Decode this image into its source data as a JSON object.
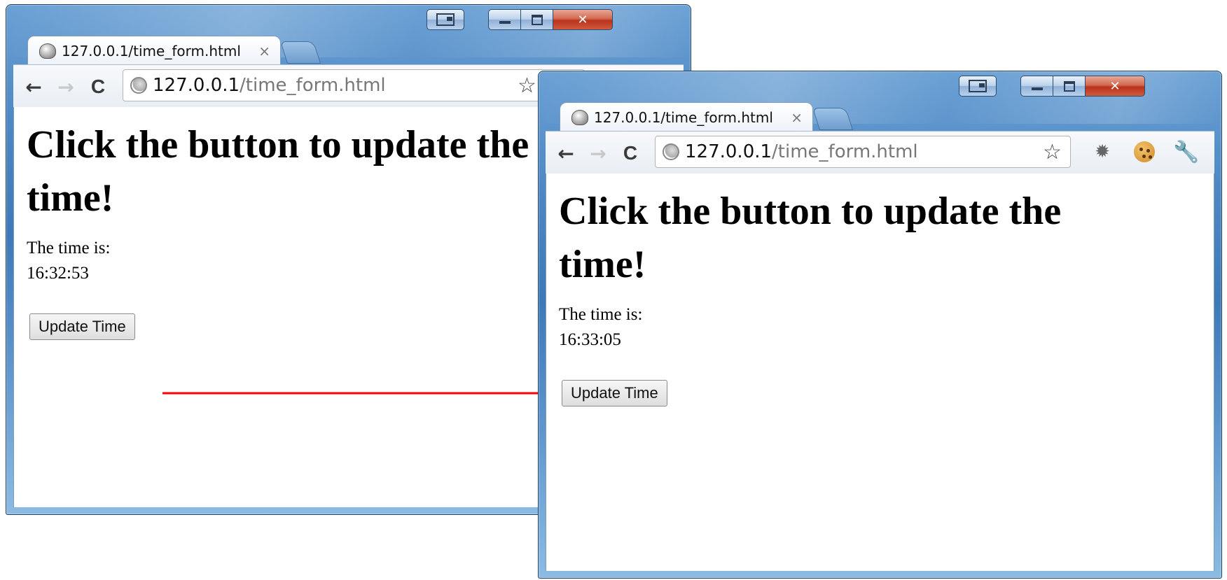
{
  "windows": [
    {
      "tab_title": "127.0.0.1/time_form.html",
      "tab_close": "×",
      "url_host": "127.0.0.1",
      "url_path": "/time_form.html",
      "heading": "Click the button to update the time!",
      "time_label": "The time is:",
      "time_value": "16:32:53",
      "button_label": "Update Time"
    },
    {
      "tab_title": "127.0.0.1/time_form.html",
      "tab_close": "×",
      "url_host": "127.0.0.1",
      "url_path": "/time_form.html",
      "heading": "Click the button to update the time!",
      "time_label": "The time is:",
      "time_value": "16:33:05",
      "button_label": "Update Time"
    }
  ],
  "nav": {
    "back": "←",
    "forward": "→",
    "reload": "C",
    "star": "☆"
  },
  "icons": [
    "window-dock-icon",
    "minimize-icon",
    "maximize-icon",
    "close-icon",
    "page-favicon",
    "globe-icon",
    "star-icon",
    "gear-icon",
    "cookie-icon",
    "wrench-icon"
  ],
  "colors": {
    "arrow": "#ff0000",
    "frame": "#4f89c4",
    "close_button": "#c8452c"
  }
}
